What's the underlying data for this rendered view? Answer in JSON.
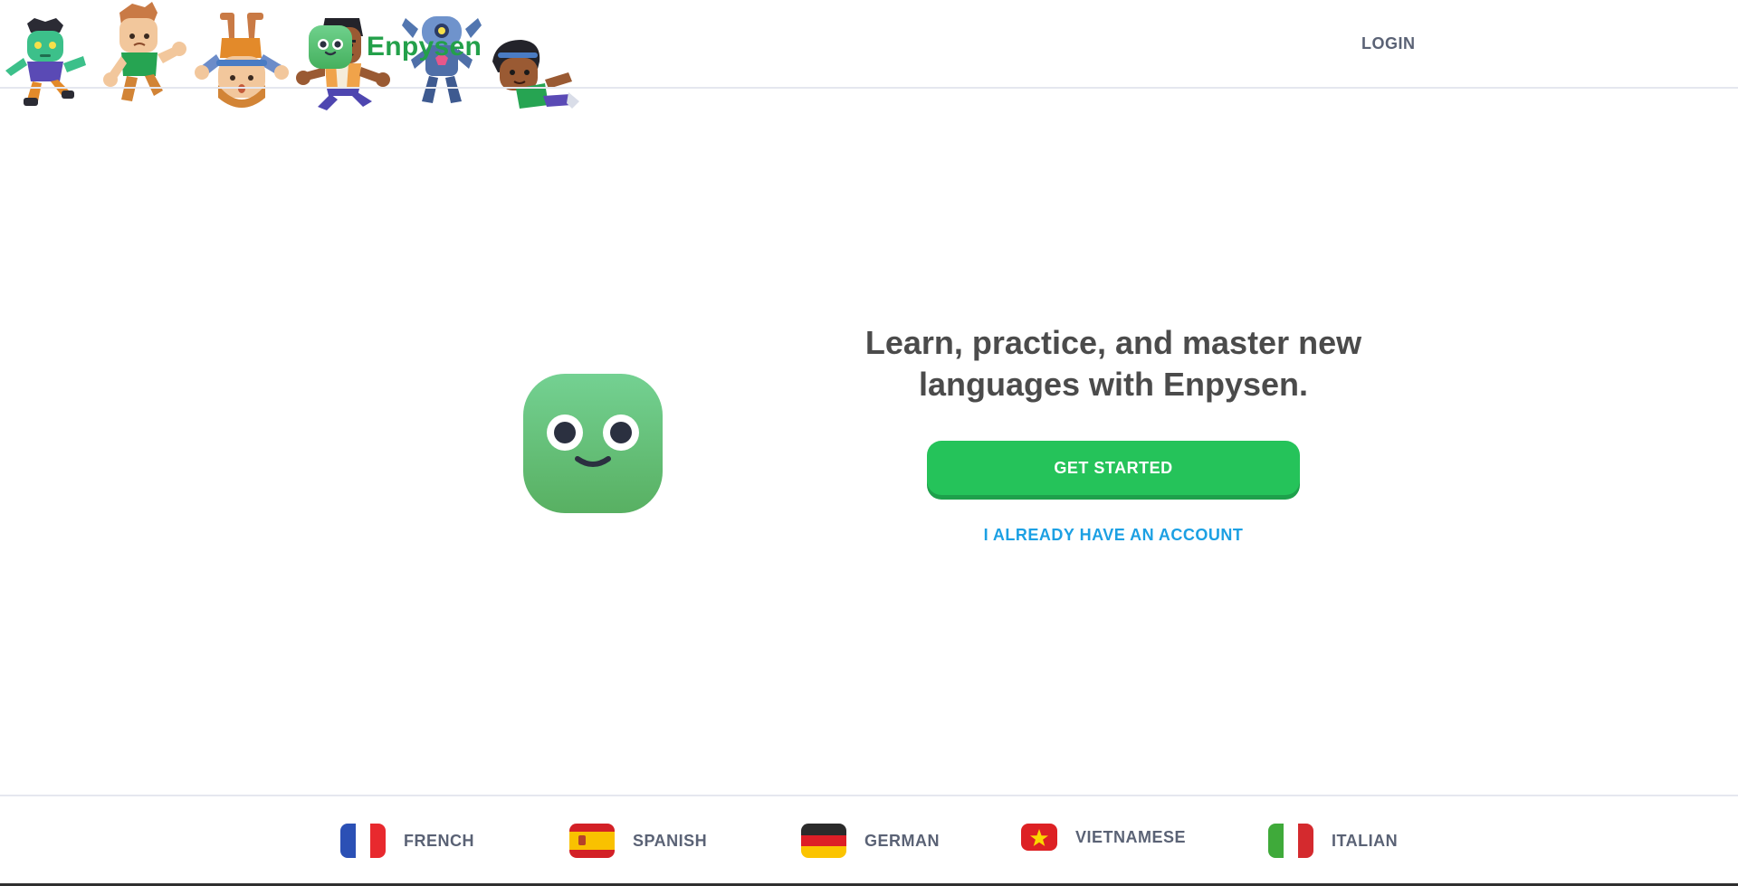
{
  "brand": {
    "name": "Enpysen",
    "color": "#23a04a",
    "logo_icon": "mascot-icon"
  },
  "header": {
    "login_label": "LOGIN"
  },
  "hero": {
    "headline": "Learn, practice, and master new languages with Enpysen.",
    "primary_button": "GET STARTED",
    "secondary_button": "I ALREADY HAVE AN ACCOUNT",
    "characters": [
      "zombie-character-icon",
      "boy-character-icon",
      "upside-down-girl-character-icon",
      "man-character-icon",
      "robot-character-icon",
      "girl-character-icon",
      "mascot-icon"
    ]
  },
  "footer": {
    "languages": [
      {
        "label": "FRENCH",
        "flag": "france-flag-icon"
      },
      {
        "label": "SPANISH",
        "flag": "spain-flag-icon"
      },
      {
        "label": "GERMAN",
        "flag": "germany-flag-icon"
      },
      {
        "label": "VIETNAMESE",
        "flag": "vietnam-flag-icon"
      },
      {
        "label": "ITALIAN",
        "flag": "italy-flag-icon"
      }
    ]
  },
  "colors": {
    "primary_green": "#25c35a",
    "link_blue": "#1ca0e3",
    "text_dark": "#4b4b4b",
    "text_muted": "#5a6275",
    "border": "#e5e7ef"
  }
}
